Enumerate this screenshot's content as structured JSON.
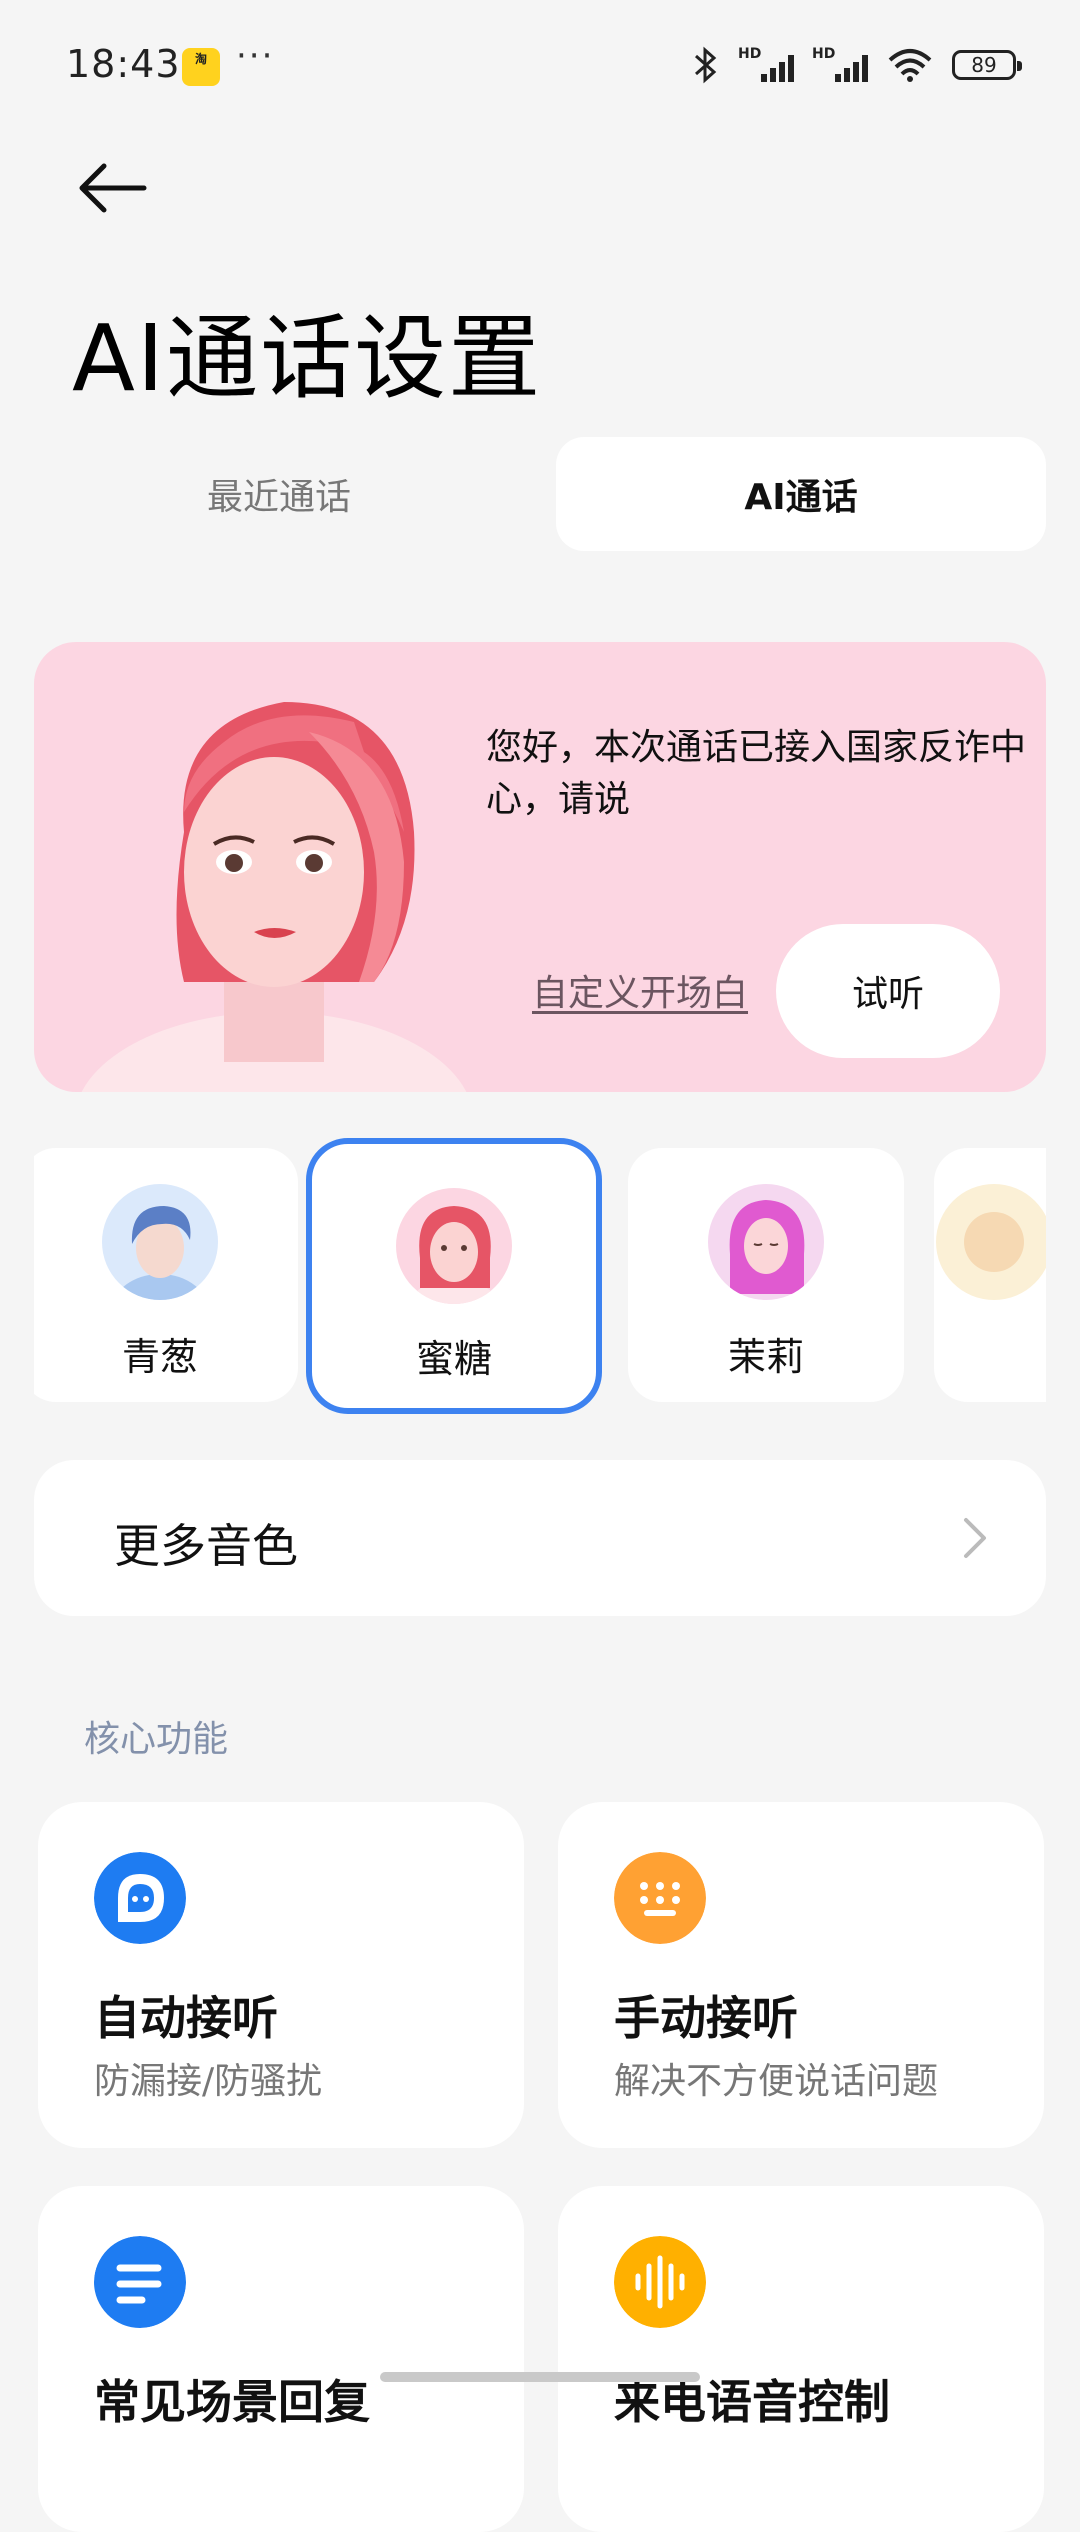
{
  "status_bar": {
    "time": "18:43",
    "app_badge": "淘",
    "more": "···",
    "battery": "89",
    "signal_label": "HD"
  },
  "header": {
    "title": "AI通话设置"
  },
  "tabs": [
    {
      "label": "最近通话",
      "active": false
    },
    {
      "label": "AI通话",
      "active": true
    }
  ],
  "hero": {
    "greeting": "您好，本次通话已接入国家反诈中心，请说",
    "custom_opening_link": "自定义开场白",
    "listen_button": "试听"
  },
  "voices": [
    {
      "name": "青葱",
      "selected": false
    },
    {
      "name": "蜜糖",
      "selected": true
    },
    {
      "name": "茉莉",
      "selected": false
    },
    {
      "name": "",
      "selected": false
    }
  ],
  "more_voices": {
    "label": "更多音色"
  },
  "core_section": {
    "label": "核心功能",
    "features": [
      {
        "title": "自动接听",
        "subtitle": "防漏接/防骚扰",
        "icon": "chat-bubble-icon",
        "color": "#1e7cf2"
      },
      {
        "title": "手动接听",
        "subtitle": "解决不方便说话问题",
        "icon": "keypad-icon",
        "color": "#ffa133"
      },
      {
        "title": "常见场景回复",
        "subtitle": "",
        "icon": "message-lines-icon",
        "color": "#1e7cf2"
      },
      {
        "title": "来电语音控制",
        "subtitle": "",
        "icon": "sound-wave-icon",
        "color": "#ffb000"
      }
    ]
  },
  "colors": {
    "accent_blue": "#3d82f0",
    "hero_pink": "#fcd6e2",
    "section_label": "#8391ab"
  }
}
